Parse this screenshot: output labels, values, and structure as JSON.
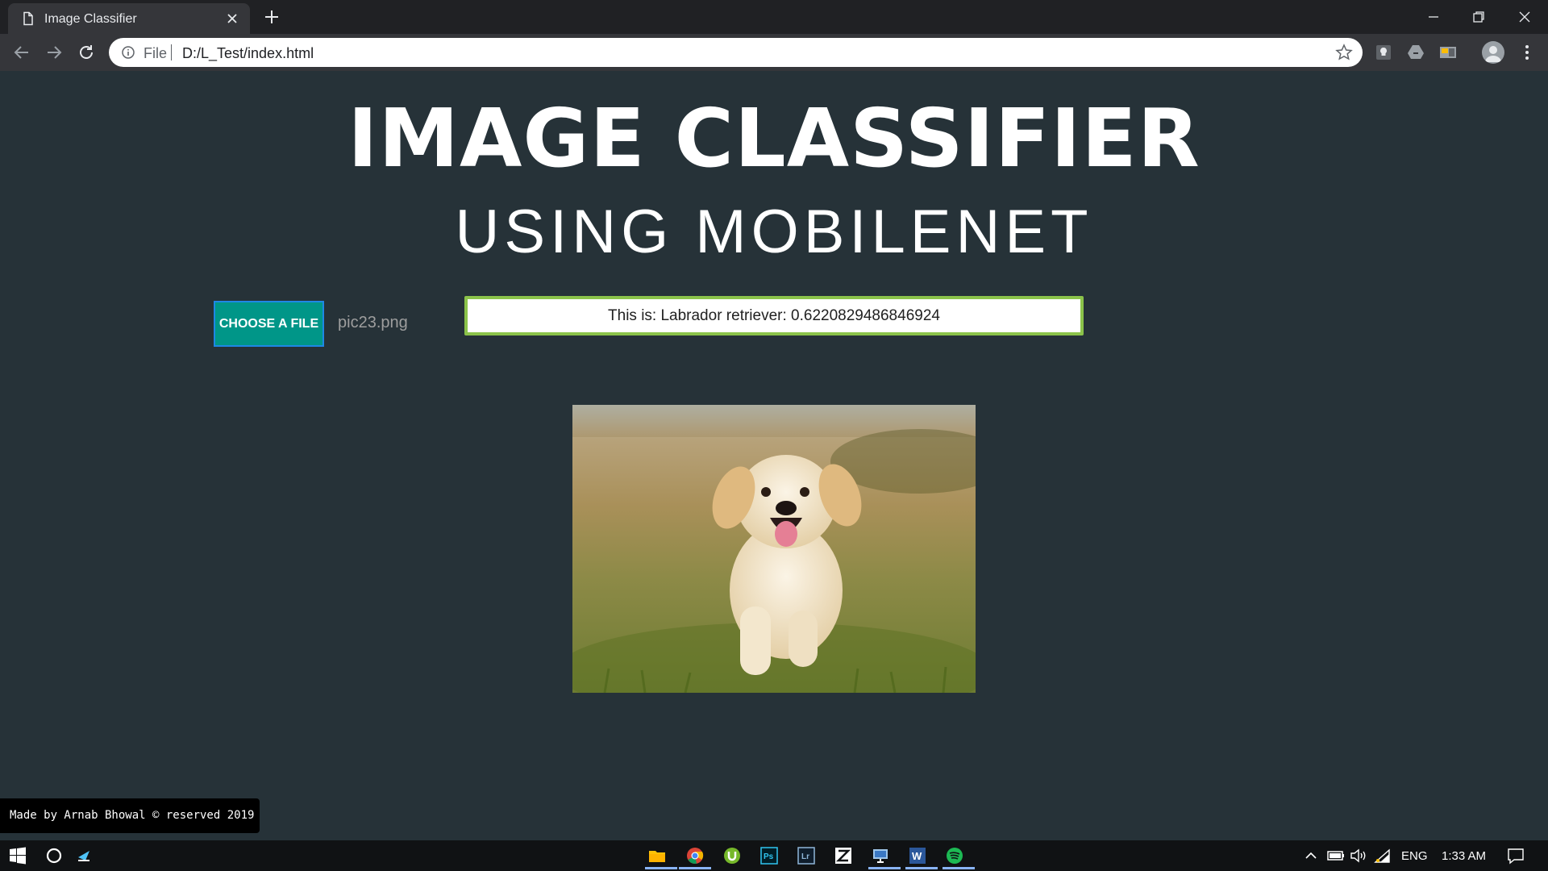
{
  "browser": {
    "tab_title": "Image Classifier",
    "url_scheme": "File",
    "url": "D:/L_Test/index.html"
  },
  "page": {
    "title": "IMAGE CLASSIFIER",
    "subtitle": "USING MOBILENET",
    "choose_button_label": "CHOOSE A FILE",
    "file_name": "pic23.png",
    "result_text": "This is: Labrador retriever: 0.6220829486846924",
    "footer_text": "Made by Arnab Bhowal © reserved 2019"
  },
  "taskbar": {
    "language": "ENG",
    "time": "1:33 AM"
  },
  "colors": {
    "page_background": "#263238",
    "choose_button": "#009688",
    "result_border": "#8bc34a"
  }
}
